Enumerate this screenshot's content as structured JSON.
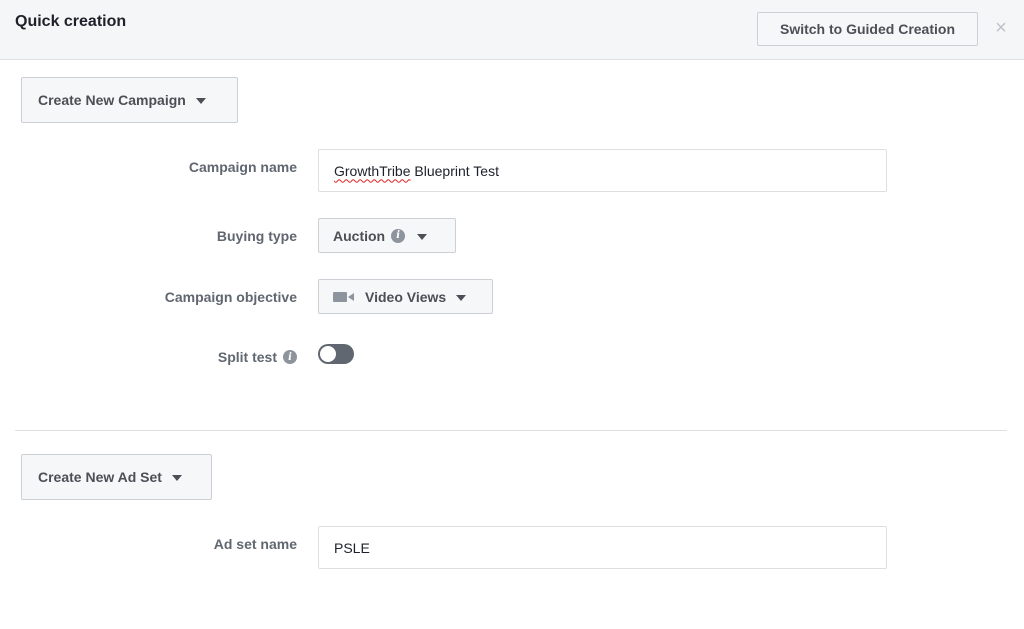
{
  "header": {
    "title": "Quick creation",
    "switch_button": "Switch to Guided Creation",
    "close_glyph": "×"
  },
  "campaign": {
    "section_button": "Create New Campaign",
    "name_label": "Campaign name",
    "name_value_part1": "GrowthTribe",
    "name_value_part2": " Blueprint Test",
    "buying_type_label": "Buying type",
    "buying_type_value": "Auction",
    "objective_label": "Campaign objective",
    "objective_value": "Video Views",
    "objective_icon": "video-camera-icon",
    "split_test_label": "Split test",
    "split_test_on": false
  },
  "ad_set": {
    "section_button": "Create New Ad Set",
    "name_label": "Ad set name",
    "name_value": "PSLE"
  },
  "colors": {
    "header_bg": "#f5f6f7",
    "label_text": "#606770",
    "toggle_off": "#606770"
  }
}
